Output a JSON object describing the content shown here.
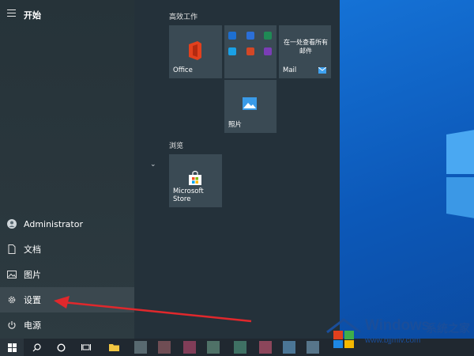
{
  "start_menu": {
    "title": "开始",
    "rail": {
      "user": "Administrator",
      "documents": "文档",
      "pictures": "图片",
      "settings": "设置",
      "power": "电源"
    },
    "groups": [
      {
        "label": "高效工作"
      },
      {
        "label": "浏览"
      }
    ],
    "tiles": {
      "office": "Office",
      "mail_desc": "在一处查看所有邮件",
      "mail": "Mail",
      "photos": "照片",
      "store": "Microsoft Store"
    }
  },
  "watermark": {
    "title": "Windows",
    "title_cn": "系统之家",
    "url": "www.bjjmlv.com"
  },
  "colors": {
    "accent": "#0c58b8",
    "office_red": "#e2401d",
    "arrow_red": "#e0282c"
  }
}
